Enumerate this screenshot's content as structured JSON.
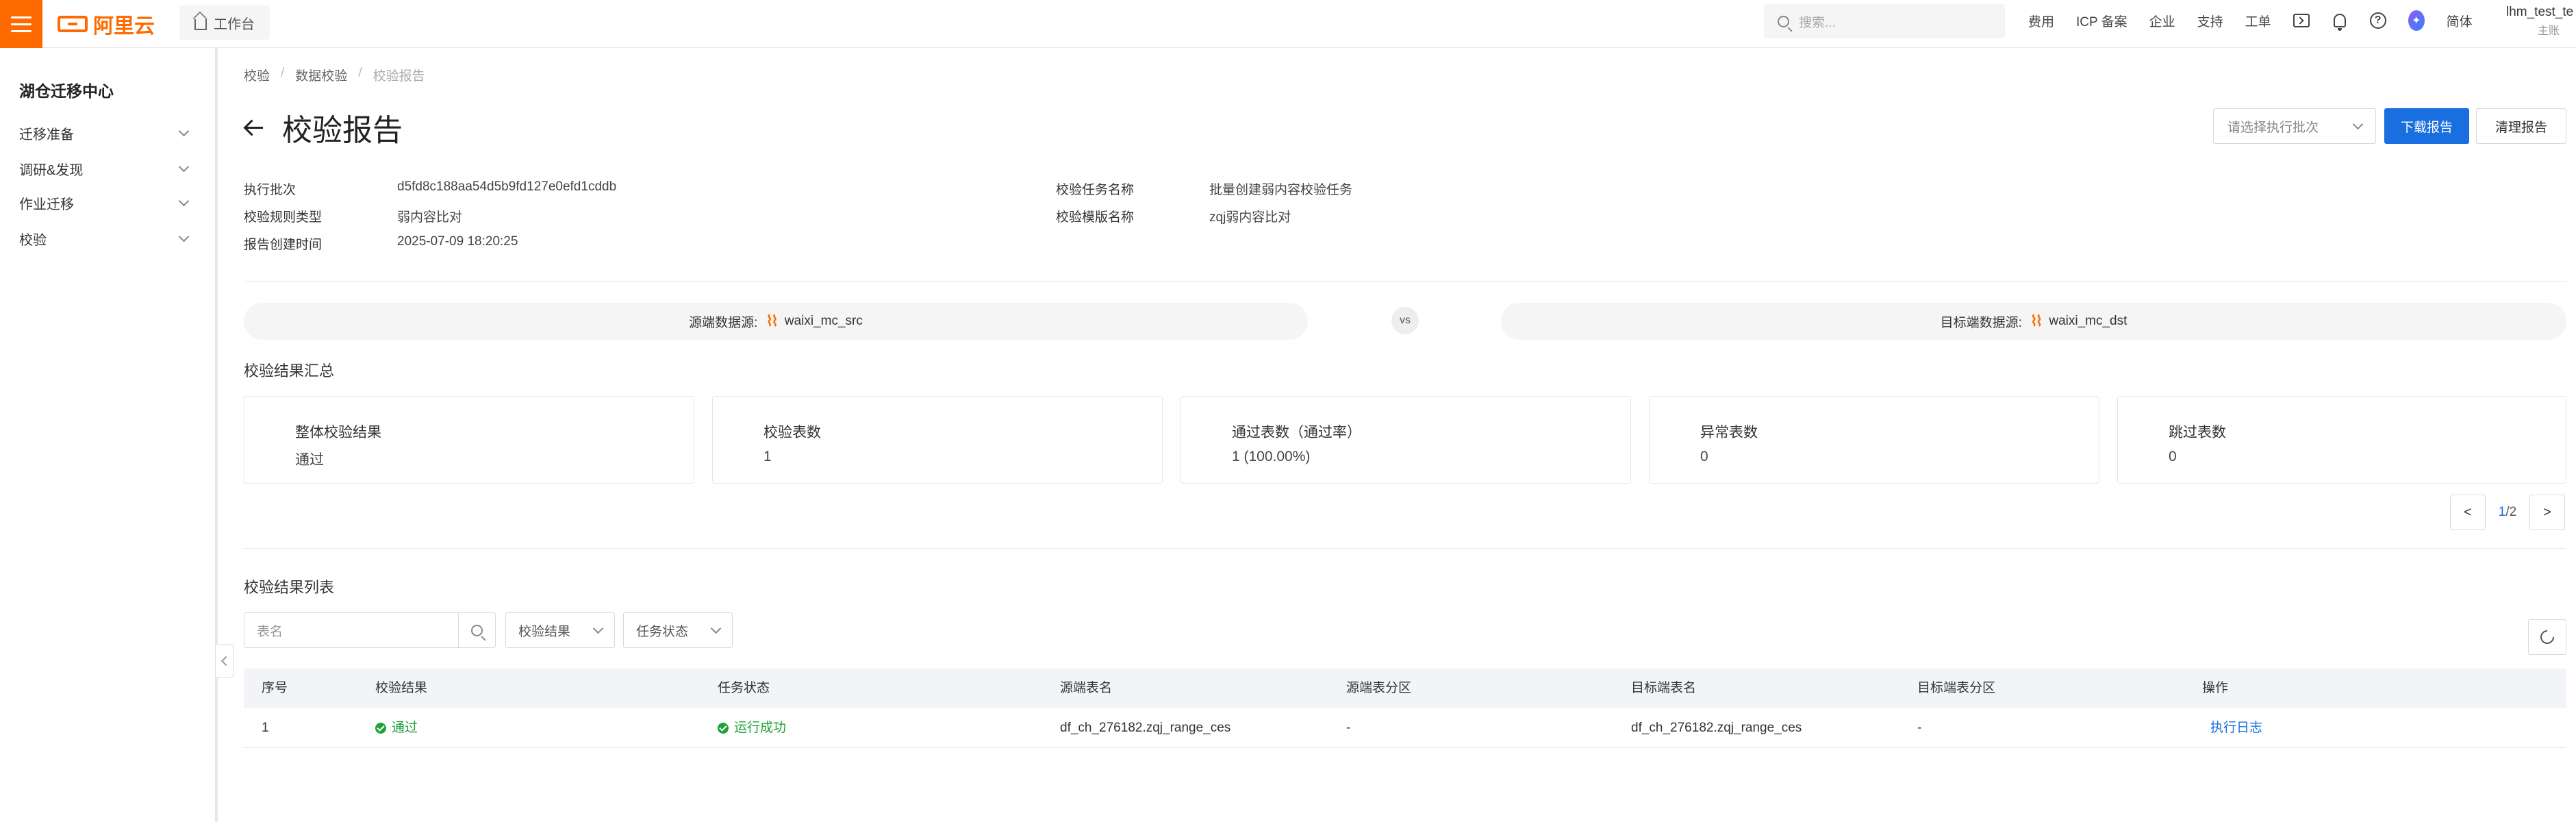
{
  "topbar": {
    "logo_text": "阿里云",
    "workbench_label": "工作台",
    "search_placeholder": "搜索...",
    "links": [
      "费用",
      "ICP 备案",
      "企业",
      "支持",
      "工单"
    ],
    "lang": "简体",
    "account_name": "lhm_test_te",
    "account_role": "主账"
  },
  "sidebar": {
    "title": "湖仓迁移中心",
    "items": [
      {
        "label": "迁移准备"
      },
      {
        "label": "调研&发现"
      },
      {
        "label": "作业迁移"
      },
      {
        "label": "校验"
      }
    ]
  },
  "breadcrumb": [
    "校验",
    "数据校验",
    "校验报告"
  ],
  "page_title": "校验报告",
  "header_actions": {
    "batch_select_placeholder": "请选择执行批次",
    "download_label": "下载报告",
    "clear_label": "清理报告"
  },
  "info": {
    "batch_key": "执行批次",
    "batch_value": "d5fd8c188aa54d5b9fd127e0efd1cddb",
    "rule_type_key": "校验规则类型",
    "rule_type_value": "弱内容比对",
    "created_key": "报告创建时间",
    "created_value": "2025-07-09 18:20:25",
    "task_name_key": "校验任务名称",
    "task_name_value": "批量创建弱内容校验任务",
    "template_key": "校验模版名称",
    "template_value": "zqj弱内容比对"
  },
  "compare": {
    "source_label": "源端数据源:",
    "source_value": "waixi_mc_src",
    "vs": "vs",
    "target_label": "目标端数据源:",
    "target_value": "waixi_mc_dst",
    "icon_glyph": "⌇⌇"
  },
  "summary": {
    "title": "校验结果汇总",
    "cards": [
      {
        "label": "整体校验结果",
        "value": "通过"
      },
      {
        "label": "校验表数",
        "value": "1"
      },
      {
        "label": "通过表数（通过率）",
        "value": "1 (100.00%)"
      },
      {
        "label": "异常表数",
        "value": "0"
      },
      {
        "label": "跳过表数",
        "value": "0"
      }
    ],
    "pager": {
      "prev": "<",
      "current": "1",
      "total": "/2",
      "next": ">"
    }
  },
  "list": {
    "title": "校验结果列表",
    "search_placeholder": "表名",
    "filter_result": "校验结果",
    "filter_status": "任务状态",
    "columns": [
      "序号",
      "校验结果",
      "任务状态",
      "源端表名",
      "源端表分区",
      "目标端表名",
      "目标端表分区",
      "操作"
    ],
    "rows": [
      {
        "index": "1",
        "result": "通过",
        "status": "运行成功",
        "source_table": "df_ch_276182.zqj_range_ces",
        "source_partition": "-",
        "target_table": "df_ch_276182.zqj_range_ces",
        "target_partition": "-",
        "action": "执行日志"
      }
    ]
  },
  "colors": {
    "brand": "#ff6a00",
    "primary": "#1a6fe0",
    "success": "#1fa23a"
  }
}
